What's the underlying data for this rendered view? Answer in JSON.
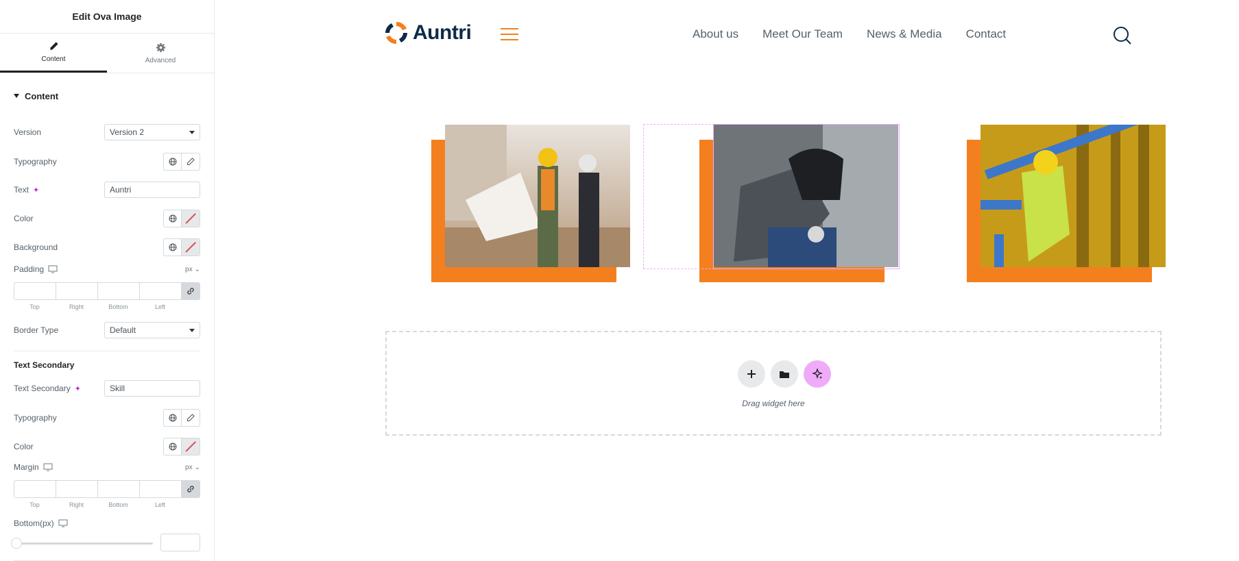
{
  "sidebar": {
    "header_title": "Edit Ova Image",
    "tabs": [
      {
        "label": "Content",
        "icon": "pencil-icon",
        "active": true
      },
      {
        "label": "Advanced",
        "icon": "gear-icon",
        "active": false
      }
    ],
    "section_title": "Content",
    "version": {
      "label": "Version",
      "value": "Version 2"
    },
    "typography": {
      "label": "Typography"
    },
    "text": {
      "label": "Text",
      "value": "Auntri"
    },
    "color": {
      "label": "Color"
    },
    "background": {
      "label": "Background"
    },
    "padding": {
      "label": "Padding",
      "unit": "px",
      "sides": [
        "Top",
        "Right",
        "Bottom",
        "Left"
      ]
    },
    "border_type": {
      "label": "Border Type",
      "value": "Default"
    },
    "text_secondary_heading": "Text Secondary",
    "text_secondary": {
      "label": "Text Secondary",
      "value": "Skill"
    },
    "typography2": {
      "label": "Typography"
    },
    "color2": {
      "label": "Color"
    },
    "margin": {
      "label": "Margin",
      "unit": "px",
      "sides": [
        "Top",
        "Right",
        "Bottom",
        "Left"
      ]
    },
    "bottom_px": {
      "label": "Bottom(px)",
      "slider_value": 0
    }
  },
  "site": {
    "logo_text": "Auntri",
    "nav": [
      "About us",
      "Meet Our Team",
      "News & Media",
      "Contact"
    ],
    "accent_color": "#f47f1e",
    "brand_color": "#0e2a47"
  },
  "drop_zone": {
    "text": "Drag widget here"
  }
}
